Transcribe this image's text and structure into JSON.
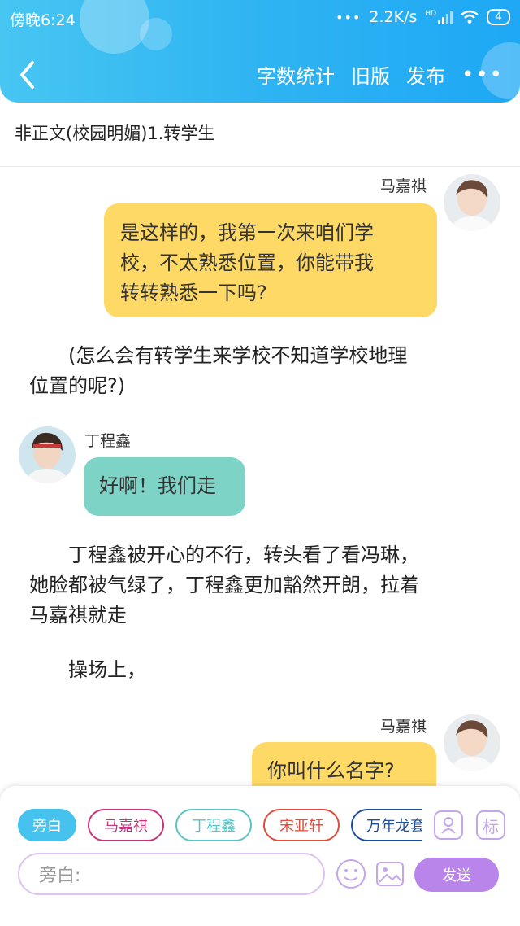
{
  "status_bar": {
    "time": "傍晚6:24",
    "network_speed": "2.2K/s",
    "signal_label": "HD",
    "battery": "4"
  },
  "nav": {
    "back_icon": "chevron-left-icon",
    "word_count": "字数统计",
    "old_version": "旧版",
    "publish": "发布",
    "more_icon": "more-dots-icon"
  },
  "document": {
    "title": "非正文(校园明媚)1.转学生"
  },
  "messages": [
    {
      "speaker": "马嘉祺",
      "side": "right",
      "text_lines": [
        "是这样的，我第一次来咱们学",
        "校，不太熟悉位置，你能带我",
        "转转熟悉一下吗?"
      ]
    },
    {
      "narration_lines": [
        "(怎么会有转学生来学校不知道学校地理",
        "位置的呢?)"
      ]
    },
    {
      "speaker": "丁程鑫",
      "side": "left",
      "text": "好啊！我们走"
    },
    {
      "narration_lines": [
        "丁程鑫被开心的不行，转头看了看冯琳，",
        "她脸都被气绿了，丁程鑫更加豁然开朗，拉着",
        "马嘉祺就走"
      ]
    },
    {
      "narration": "操场上，"
    },
    {
      "speaker": "马嘉祺",
      "side": "right",
      "text": "你叫什么名字?"
    }
  ],
  "composer": {
    "roles": [
      {
        "label": "旁白",
        "color": "#45c3ee",
        "active": true
      },
      {
        "label": "马嘉祺",
        "color": "#c6357a",
        "active": false
      },
      {
        "label": "丁程鑫",
        "color": "#5cc3c3",
        "active": false
      },
      {
        "label": "宋亚轩",
        "color": "#e14c3c",
        "active": false
      },
      {
        "label": "万年龙套",
        "color": "#1f4e9a",
        "active": false
      }
    ],
    "character_icon": "person-card-icon",
    "tag_button": "标",
    "input_placeholder": "旁白:",
    "emoji_icon": "smiley-icon",
    "image_icon": "image-icon",
    "send": "发送"
  },
  "colors": {
    "header": "#2fb4f2",
    "yellow_bubble": "#ffd966",
    "teal_bubble": "#7dd3c6",
    "accent": "#b985eb"
  }
}
